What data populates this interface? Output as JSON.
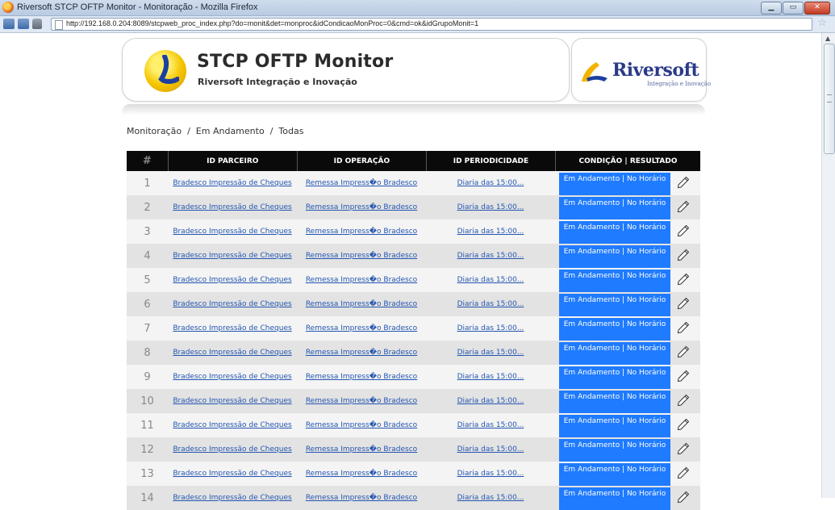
{
  "window": {
    "title": "Riversoft STCP OFTP Monitor - Monitoração - Mozilla Firefox",
    "url": "http://192.168.0.204:8089/stcpweb_proc_index.php?do=monit&det=monproc&idCondicaoMonProc=0&cmd=ok&idGrupoMonit=1",
    "buttons": {
      "minimize": "▁",
      "maximize": "▭",
      "close": "✕"
    }
  },
  "banner": {
    "title": "STCP OFTP Monitor",
    "subtitle": "Riversoft Integração e Inovação",
    "brand_name": "Riversoft",
    "brand_tagline": "Integração e Inovação"
  },
  "breadcrumb": {
    "items": [
      "Monitoração",
      "Em Andamento",
      "Todas"
    ],
    "separator": "/"
  },
  "table": {
    "headers": [
      "#",
      "ID PARCEIRO",
      "ID OPERAÇÃO",
      "ID PERIODICIDADE",
      "CONDIÇÃO | RESULTADO"
    ],
    "rows": [
      {
        "num": "1",
        "parceiro": "Bradesco Impressão de Cheques",
        "operacao": "Remessa Impress�o Bradesco",
        "periodicidade": "Diaria das 15:00...",
        "status": "Em Andamento | No Horário"
      },
      {
        "num": "2",
        "parceiro": "Bradesco Impressão de Cheques",
        "operacao": "Remessa Impress�o Bradesco",
        "periodicidade": "Diaria das 15:00...",
        "status": "Em Andamento | No Horário"
      },
      {
        "num": "3",
        "parceiro": "Bradesco Impressão de Cheques",
        "operacao": "Remessa Impress�o Bradesco",
        "periodicidade": "Diaria das 15:00...",
        "status": "Em Andamento | No Horário"
      },
      {
        "num": "4",
        "parceiro": "Bradesco Impressão de Cheques",
        "operacao": "Remessa Impress�o Bradesco",
        "periodicidade": "Diaria das 15:00...",
        "status": "Em Andamento | No Horário"
      },
      {
        "num": "5",
        "parceiro": "Bradesco Impressão de Cheques",
        "operacao": "Remessa Impress�o Bradesco",
        "periodicidade": "Diaria das 15:00...",
        "status": "Em Andamento | No Horário"
      },
      {
        "num": "6",
        "parceiro": "Bradesco Impressão de Cheques",
        "operacao": "Remessa Impress�o Bradesco",
        "periodicidade": "Diaria das 15:00...",
        "status": "Em Andamento | No Horário"
      },
      {
        "num": "7",
        "parceiro": "Bradesco Impressão de Cheques",
        "operacao": "Remessa Impress�o Bradesco",
        "periodicidade": "Diaria das 15:00...",
        "status": "Em Andamento | No Horário"
      },
      {
        "num": "8",
        "parceiro": "Bradesco Impressão de Cheques",
        "operacao": "Remessa Impress�o Bradesco",
        "periodicidade": "Diaria das 15:00...",
        "status": "Em Andamento | No Horário"
      },
      {
        "num": "9",
        "parceiro": "Bradesco Impressão de Cheques",
        "operacao": "Remessa Impress�o Bradesco",
        "periodicidade": "Diaria das 15:00...",
        "status": "Em Andamento | No Horário"
      },
      {
        "num": "10",
        "parceiro": "Bradesco Impressão de Cheques",
        "operacao": "Remessa Impress�o Bradesco",
        "periodicidade": "Diaria das 15:00...",
        "status": "Em Andamento | No Horário"
      },
      {
        "num": "11",
        "parceiro": "Bradesco Impressão de Cheques",
        "operacao": "Remessa Impress�o Bradesco",
        "periodicidade": "Diaria das 15:00...",
        "status": "Em Andamento | No Horário"
      },
      {
        "num": "12",
        "parceiro": "Bradesco Impressão de Cheques",
        "operacao": "Remessa Impress�o Bradesco",
        "periodicidade": "Diaria das 15:00...",
        "status": "Em Andamento | No Horário"
      },
      {
        "num": "13",
        "parceiro": "Bradesco Impressão de Cheques",
        "operacao": "Remessa Impress�o Bradesco",
        "periodicidade": "Diaria das 15:00...",
        "status": "Em Andamento | No Horário"
      },
      {
        "num": "14",
        "parceiro": "Bradesco Impressão de Cheques",
        "operacao": "Remessa Impress�o Bradesco",
        "periodicidade": "Diaria das 15:00...",
        "status": "Em Andamento | No Horário"
      }
    ]
  },
  "colors": {
    "status_bg": "#1f7bff",
    "header_bg": "#0a0a0a",
    "link": "#2456b0"
  },
  "icons": {
    "edit": "pencil-icon"
  }
}
